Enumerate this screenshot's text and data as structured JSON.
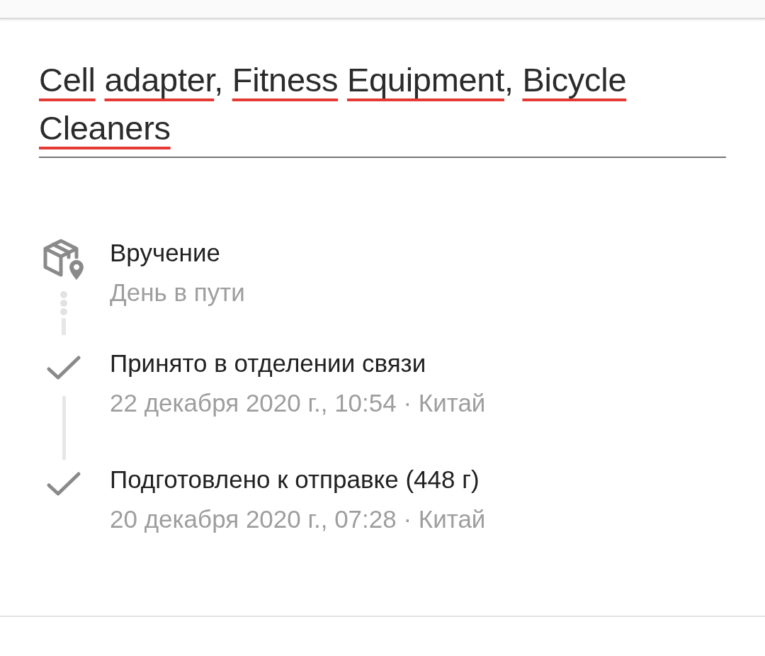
{
  "title_field": {
    "value": "Cell adapter, Fitness Equipment, Bicycle Cleaners",
    "spellcheck_errors": true
  },
  "events": [
    {
      "kind": "current",
      "title": "Вручение",
      "subtitle": "День в пути"
    },
    {
      "kind": "done",
      "title": "Принято в отделении связи",
      "subtitle": "22 декабря 2020 г., 10:54 · Китай"
    },
    {
      "kind": "done",
      "title": "Подготовлено к отправке (448 г)",
      "subtitle": "20 декабря 2020 г., 07:28 · Китай"
    }
  ]
}
